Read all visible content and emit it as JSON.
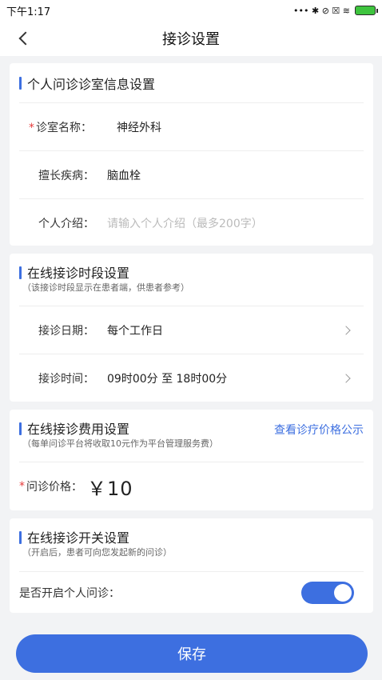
{
  "statusbar": {
    "time": "下午1:17",
    "icons_text": "••• ✱ ⊘ ☒ ≋"
  },
  "navbar": {
    "title": "接诊设置"
  },
  "section1": {
    "title": "个人问诊诊室信息设置",
    "rows": [
      {
        "required": "*",
        "label": "诊室名称：",
        "value": "神经外科"
      },
      {
        "label": "擅长疾病：",
        "value": "脑血栓"
      },
      {
        "label": "个人介绍：",
        "placeholder": "请输入个人介绍（最多200字）"
      }
    ]
  },
  "section2": {
    "title": "在线接诊时段设置",
    "subtitle": "（该接诊时段显示在患者端，供患者参考）",
    "rows": [
      {
        "label": "接诊日期：",
        "value": "每个工作日"
      },
      {
        "label": "接诊时间：",
        "value": "09时00分 至 18时00分"
      }
    ]
  },
  "section3": {
    "title": "在线接诊费用设置",
    "link": "查看诊疗价格公示",
    "subtitle": "（每单问诊平台将收取10元作为平台管理服务费）",
    "price": {
      "required": "*",
      "label": "问诊价格：",
      "value": "￥10"
    }
  },
  "section4": {
    "title": "在线接诊开关设置",
    "subtitle": "（开启后，患者可向您发起新的问诊）",
    "toggle_label": "是否开启个人问诊：",
    "toggle_on": true
  },
  "footer": {
    "save_label": "保存"
  },
  "colors": {
    "accent": "#3d6fe0",
    "required": "#e63b3b",
    "background": "#f2f3f5"
  }
}
